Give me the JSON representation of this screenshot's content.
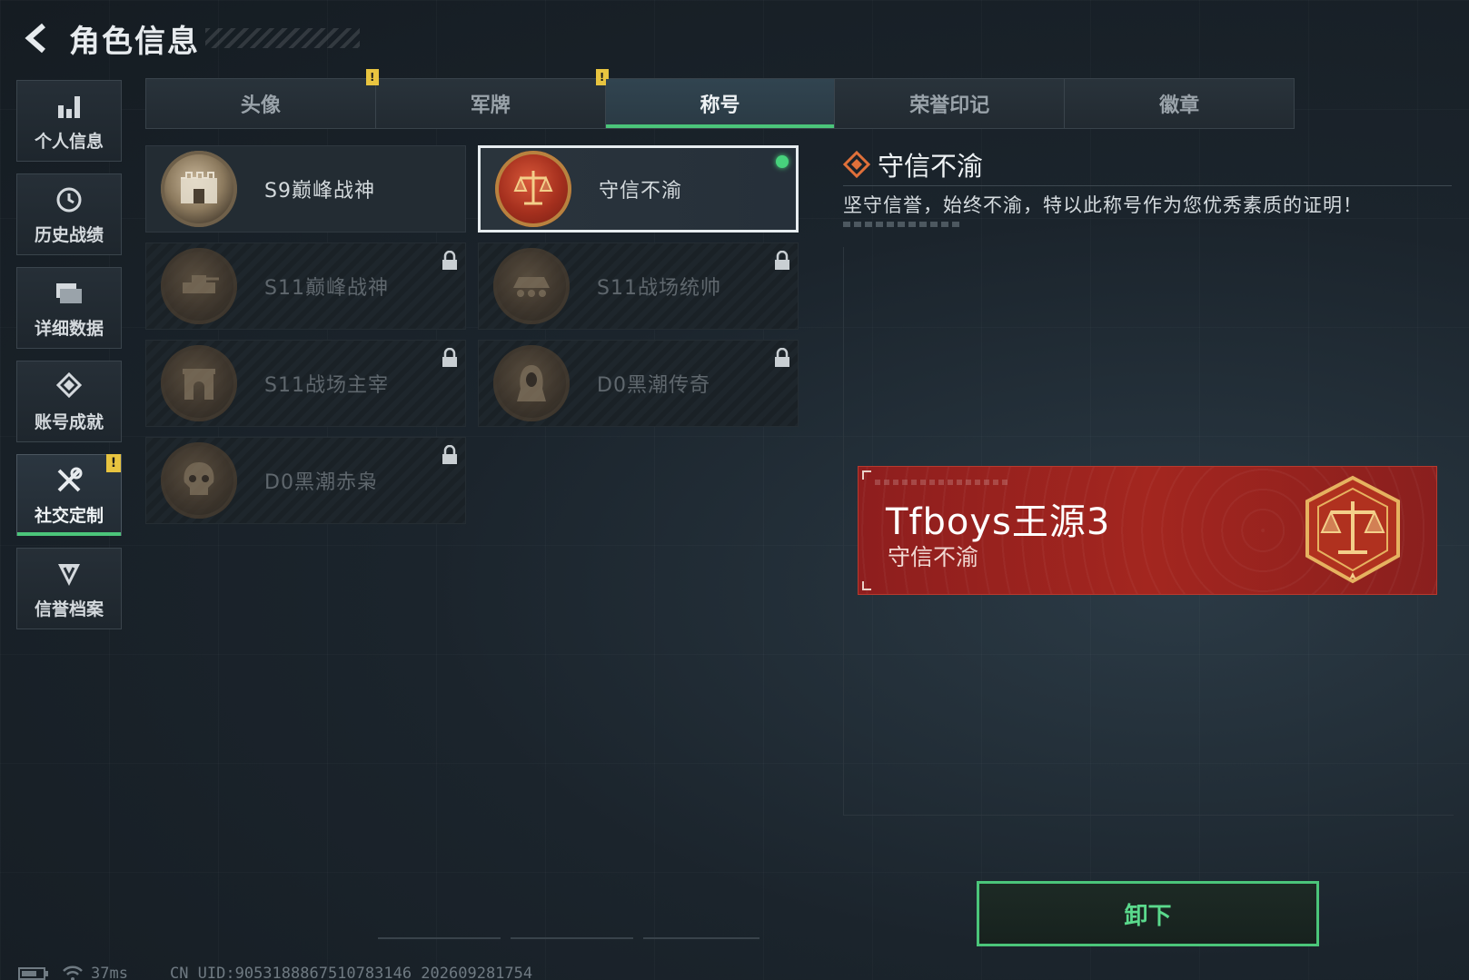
{
  "header": {
    "title": "角色信息"
  },
  "sidebar": {
    "items": [
      {
        "label": "个人信息",
        "icon": "bar-chart-icon"
      },
      {
        "label": "历史战绩",
        "icon": "clock-icon"
      },
      {
        "label": "详细数据",
        "icon": "folder-icon"
      },
      {
        "label": "账号成就",
        "icon": "achievement-icon"
      },
      {
        "label": "社交定制",
        "icon": "tools-icon",
        "active": true,
        "alert": "!"
      },
      {
        "label": "信誉档案",
        "icon": "credit-shield-icon"
      }
    ]
  },
  "tabs": [
    {
      "label": "头像",
      "alert": "!"
    },
    {
      "label": "军牌",
      "alert": "!"
    },
    {
      "label": "称号",
      "active": true
    },
    {
      "label": "荣誉印记"
    },
    {
      "label": "徽章"
    }
  ],
  "titles": [
    {
      "label": "S9巅峰战神",
      "medal": "fortress-medal-icon",
      "locked": false
    },
    {
      "label": "守信不渝",
      "medal": "scales-medal-icon",
      "locked": false,
      "selected": true,
      "equipped": true
    },
    {
      "label": "S11巅峰战神",
      "medal": "tank-medal-icon",
      "locked": true
    },
    {
      "label": "S11战场统帅",
      "medal": "apc-medal-icon",
      "locked": true
    },
    {
      "label": "S11战场主宰",
      "medal": "arch-medal-icon",
      "locked": true
    },
    {
      "label": "D0黑潮传奇",
      "medal": "hooded-figure-medal-icon",
      "locked": true
    },
    {
      "label": "D0黑潮赤枭",
      "medal": "skull-medal-icon",
      "locked": true
    }
  ],
  "detail": {
    "name": "守信不渝",
    "description": "坚守信誉，始终不渝，特以此称号作为您优秀素质的证明！"
  },
  "preview": {
    "player_name": "Tfboys王源3",
    "title": "守信不渝"
  },
  "actions": {
    "unequip_label": "卸下"
  },
  "status": {
    "ping": "37ms",
    "uid": "CN UID:9053188867510783146 202609281754"
  },
  "colors": {
    "accent_green": "#4bc57a",
    "alert_yellow": "#e8c440",
    "banner_red": "#a3261f"
  }
}
